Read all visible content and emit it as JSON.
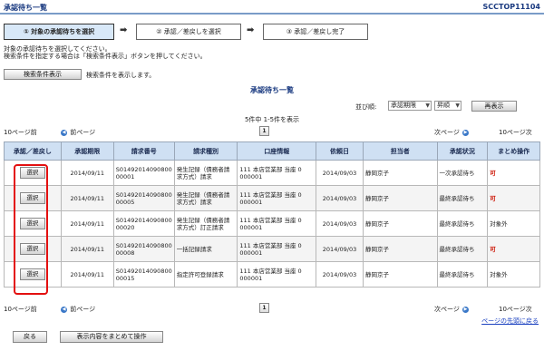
{
  "header": {
    "title": "承認待ち一覧",
    "screen_code": "SCCTOP11104"
  },
  "steps": [
    {
      "label": "① 対象の承認待ちを選択",
      "active": true
    },
    {
      "label": "② 承認／差戻しを選択",
      "active": false
    },
    {
      "label": "③ 承認／差戻し完了",
      "active": false
    }
  ],
  "step_arrow": "➡",
  "description": {
    "line1": "対象の承認待ちを選択してください。",
    "line2": "検索条件を指定する場合は「検索条件表示」ボタンを押してください。"
  },
  "search": {
    "button_label": "検索条件表示",
    "status_text": "検索条件を表示します。"
  },
  "list": {
    "title": "承認待ち一覧",
    "sort_label": "並び順:",
    "sort_value": "承認期限",
    "order_value": "昇順",
    "redisplay_label": "再表示",
    "count_text": "5件中 1-5件を表示"
  },
  "pager": {
    "prev10": "10ページ前",
    "prev": "前ページ",
    "page": "1",
    "next": "次ページ",
    "next10": "10ページ次"
  },
  "table": {
    "headers": [
      "承認／差戻し",
      "承認期限",
      "請求番号",
      "請求種別",
      "口座情報",
      "依頼日",
      "担当者",
      "承認状況",
      "まとめ操作"
    ],
    "select_label": "選択",
    "rows": [
      {
        "deadline": "2014/09/11",
        "request_no": "S01492014090800 00001",
        "type": "発生記録（債務者請求方式）請求",
        "account": "111 本店営業部 当座 0 000001",
        "request_date": "2014/09/03",
        "person": "静岡京子",
        "status": "一次承認待ち",
        "bulk": "可"
      },
      {
        "deadline": "2014/09/11",
        "request_no": "S01492014090800 00005",
        "type": "発生記録（債務者請求方式）請求",
        "account": "111 本店営業部 当座 0 000001",
        "request_date": "2014/09/03",
        "person": "静岡京子",
        "status": "最終承認待ち",
        "bulk": "可"
      },
      {
        "deadline": "2014/09/11",
        "request_no": "S01492014090800 00020",
        "type": "発生記録（債務者請求方式）訂正請求",
        "account": "111 本店営業部 当座 0 000001",
        "request_date": "2014/09/03",
        "person": "静岡京子",
        "status": "最終承認待ち",
        "bulk": "対象外"
      },
      {
        "deadline": "2014/09/11",
        "request_no": "S01492014090800 00008",
        "type": "一括記録請求",
        "account": "111 本店営業部 当座 0 000001",
        "request_date": "2014/09/03",
        "person": "静岡京子",
        "status": "最終承認待ち",
        "bulk": "可"
      },
      {
        "deadline": "2014/09/11",
        "request_no": "S01492014090800 00015",
        "type": "指定許可登録請求",
        "account": "111 本店営業部 当座 0 000001",
        "request_date": "2014/09/03",
        "person": "静岡京子",
        "status": "最終承認待ち",
        "bulk": "対象外"
      }
    ]
  },
  "footer": {
    "back_to_top": "ページの先頭に戻る",
    "back_label": "戻る",
    "bulk_label": "表示内容をまとめて操作"
  },
  "colors": {
    "accent": "#1a3a80",
    "header_bg": "#cfe0f3",
    "highlight": "#e31010",
    "ok_mark": "#cc1100"
  }
}
